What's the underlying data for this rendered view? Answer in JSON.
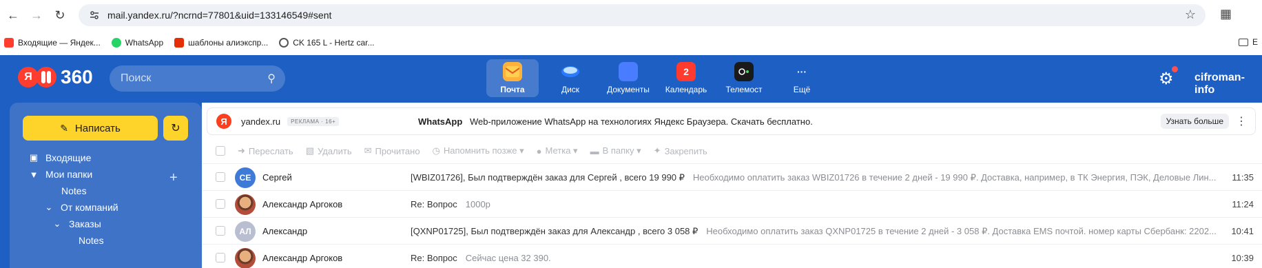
{
  "browser": {
    "url": "mail.yandex.ru/?ncrnd=77801&uid=133146549#sent",
    "bookmarks": [
      {
        "label": "Входящие — Яндек...",
        "icon": "mail-icon"
      },
      {
        "label": "WhatsApp",
        "icon": "whatsapp-icon"
      },
      {
        "label": "шаблоны алиэкспр...",
        "icon": "aliexpress-icon"
      },
      {
        "label": "CK 165 L - Hertz car...",
        "icon": "globe-icon"
      }
    ],
    "bookmarks_right_label": "E"
  },
  "header": {
    "logo_letter": "Я",
    "logo_number": "360",
    "search_placeholder": "Поиск",
    "services": [
      {
        "label": "Почта",
        "icon": "mail-icon",
        "active": true,
        "color": "#ffb23b"
      },
      {
        "label": "Диск",
        "icon": "disk-icon",
        "active": false,
        "color": "#3d8bff"
      },
      {
        "label": "Документы",
        "icon": "documents-icon",
        "active": false,
        "color": "#4a7cff"
      },
      {
        "label": "Календарь",
        "icon": "calendar-icon",
        "active": false,
        "badge": "2",
        "color": "#ff3b30"
      },
      {
        "label": "Телемост",
        "icon": "telemost-icon",
        "active": false,
        "color": "#1a1a1a"
      },
      {
        "label": "Ещё",
        "icon": "more-icon",
        "active": false,
        "glyph": "···"
      }
    ],
    "username": "cifroman-info"
  },
  "sidebar": {
    "compose_label": "Написать",
    "folders": [
      {
        "label": "Входящие",
        "icon": "inbox-icon"
      },
      {
        "label": "Мои папки",
        "icon": "folders-icon"
      },
      {
        "label": "Notes",
        "icon": ""
      },
      {
        "label": "От компаний",
        "icon": "chevron-down-icon"
      },
      {
        "label": "Заказы",
        "icon": "chevron-down-icon"
      },
      {
        "label": "Notes",
        "icon": ""
      }
    ]
  },
  "ad": {
    "logo_letter": "Я",
    "domain": "yandex.ru",
    "tag": "РЕКЛАМА · 16+",
    "brand": "WhatsApp",
    "text": "Web-приложение WhatsApp на технологиях Яндекс Браузера. Скачать бесплатно.",
    "cta": "Узнать больше"
  },
  "toolbar": {
    "items": [
      {
        "label": "Переслать",
        "icon": "forward-icon"
      },
      {
        "label": "Удалить",
        "icon": "trash-icon"
      },
      {
        "label": "Прочитано",
        "icon": "read-icon"
      },
      {
        "label": "Напомнить позже ▾",
        "icon": "reminder-icon"
      },
      {
        "label": "Метка ▾",
        "icon": "label-icon"
      },
      {
        "label": "В папку ▾",
        "icon": "folder-icon"
      },
      {
        "label": "Закрепить",
        "icon": "pin-icon"
      }
    ]
  },
  "messages": [
    {
      "avatar": "СЕ",
      "avatar_color": "#3f7bd6",
      "sender": "Сергей",
      "subject": "[WBIZ01726], Был подтверждён заказ для Сергей , всего 19 990 ₽",
      "snippet": "Необходимо оплатить заказ WBIZ01726 в течение 2 дней - 19 990 ₽. Доставка, например, в ТК Энергия, ПЭК, Деловые Лин...",
      "time": "11:35"
    },
    {
      "avatar": "",
      "avatar_color": "",
      "sender": "Александр Аргоков",
      "subject": "Re: Вопрос",
      "snippet": "1000р",
      "time": "11:24"
    },
    {
      "avatar": "АЛ",
      "avatar_color": "#b9bfd1",
      "sender": "Александр",
      "subject": "[QXNP01725], Был подтверждён заказ для Александр , всего 3 058 ₽",
      "snippet": "Необходимо оплатить заказ QXNP01725 в течение 2 дней - 3 058 ₽. Доставка EMS почтой. номер карты Сбербанк: 2202...",
      "time": "10:41"
    },
    {
      "avatar": "",
      "avatar_color": "",
      "sender": "Александр Аргоков",
      "subject": "Re: Вопрос",
      "snippet": "Сейчас цена 32 390.",
      "time": "10:39"
    }
  ]
}
